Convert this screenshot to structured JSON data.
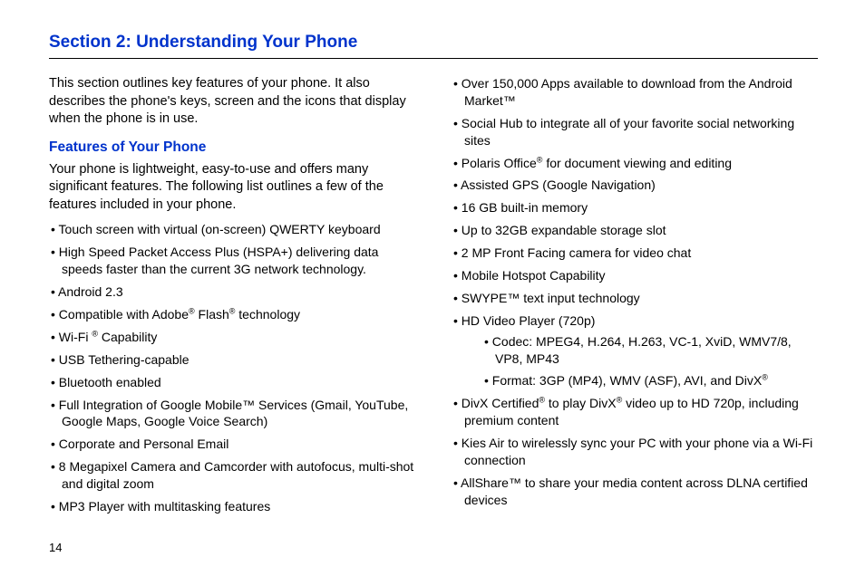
{
  "section_title": "Section 2: Understanding Your Phone",
  "intro": "This section outlines key features of your phone. It also describes the phone's keys, screen and the icons that display when the phone is in use.",
  "subsection_title": "Features of Your Phone",
  "subsection_intro": "Your phone is lightweight, easy-to-use and offers many significant features. The following list outlines a few of the features included in your phone.",
  "left_features": [
    "Touch screen with virtual (on-screen) QWERTY keyboard",
    "High Speed Packet Access Plus (HSPA+) delivering data speeds faster than the current 3G network technology.",
    "Android 2.3",
    "Compatible with Adobe® Flash® technology",
    "Wi-Fi ® Capability",
    "USB Tethering-capable",
    "Bluetooth enabled",
    "Full Integration of Google Mobile™ Services (Gmail, YouTube, Google Maps, Google Voice Search)",
    "Corporate and Personal Email",
    "8 Megapixel Camera and Camcorder with autofocus, multi-shot and digital zoom",
    "MP3 Player with multitasking features"
  ],
  "right_features": [
    "Over 150,000 Apps available to download from the Android Market™",
    "Social Hub to integrate all of your favorite social networking sites",
    "Polaris Office® for document viewing and editing",
    "Assisted GPS (Google Navigation)",
    "16 GB built-in memory",
    "Up to 32GB expandable storage slot",
    "2 MP Front Facing camera for video chat",
    "Mobile Hotspot Capability",
    "SWYPE™ text input technology",
    "HD Video Player (720p)",
    "DivX Certified® to play DivX® video up to HD 720p, including premium content",
    "Kies Air to wirelessly sync your PC with your phone via a Wi-Fi connection",
    "AllShare™ to share your media content across DLNA certified devices"
  ],
  "hd_sublist": [
    "Codec: MPEG4, H.264, H.263, VC-1, XviD, WMV7/8, VP8, MP43",
    "Format: 3GP (MP4), WMV (ASF), AVI, and DivX®"
  ],
  "page_number": "14"
}
